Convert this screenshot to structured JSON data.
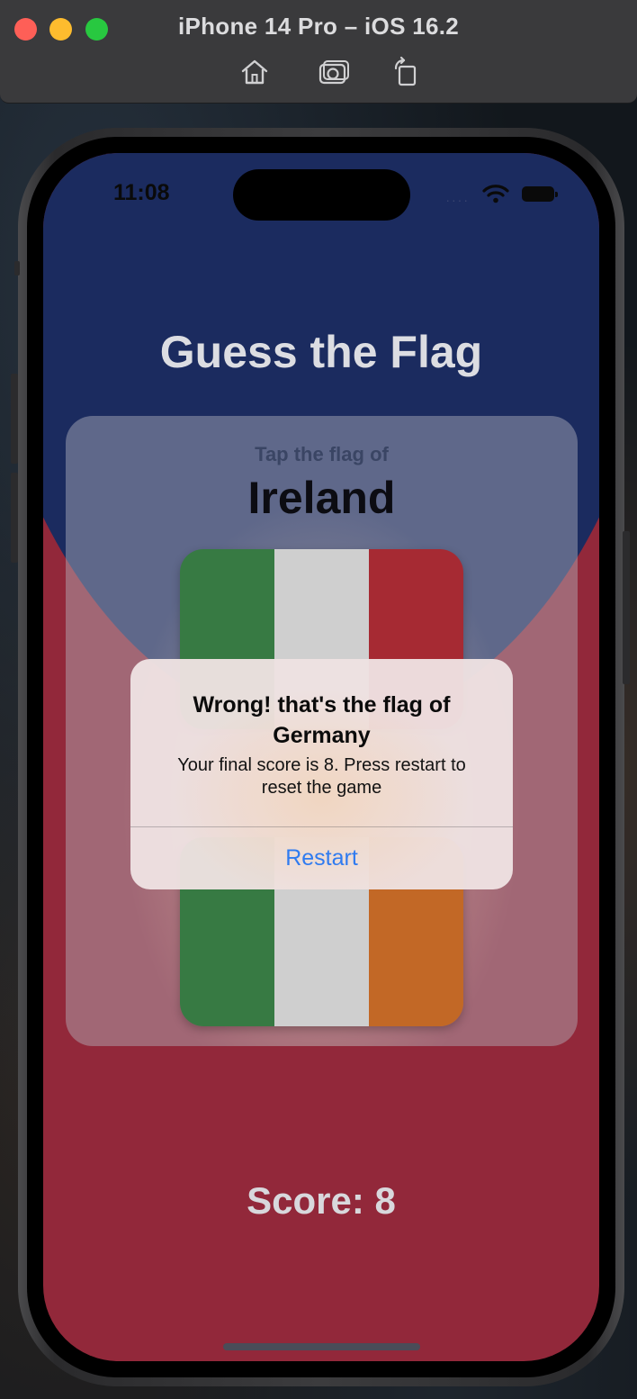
{
  "window": {
    "title": "iPhone 14 Pro – iOS 16.2",
    "toolbar": [
      "home-icon",
      "screenshot-icon",
      "rotate-icon"
    ]
  },
  "status_bar": {
    "time": "11:08",
    "icons": [
      "signal-icon",
      "wifi-icon",
      "battery-icon"
    ]
  },
  "app": {
    "title": "Guess the Flag",
    "prompt": "Tap the flag of",
    "country": "Ireland",
    "score_label": "Score: 8"
  },
  "flags": {
    "top": {
      "country": "Italy",
      "colors": [
        "#377a43",
        "#cfcfcf",
        "#a62a33"
      ]
    },
    "bottom": {
      "country": "Ireland",
      "colors": [
        "#377a43",
        "#cfcfcf",
        "#c26826"
      ]
    }
  },
  "alert": {
    "title": "Wrong! that's the flag of Germany",
    "message": "Your final score is 8. Press restart to reset the game",
    "button": "Restart"
  },
  "colors": {
    "background_top": "#1b2b5f",
    "background_bottom": "#92283a",
    "alert_button": "#2f7bf0"
  }
}
